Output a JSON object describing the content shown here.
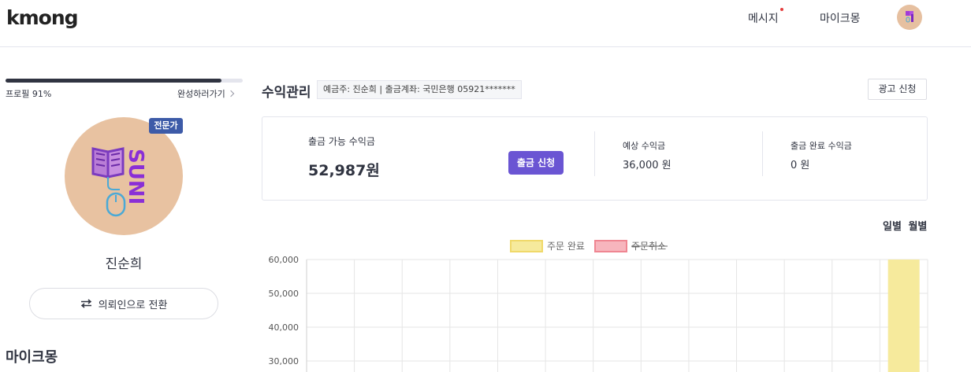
{
  "header": {
    "logo": "kmong",
    "nav": {
      "messages": "메시지",
      "mykmong": "마이크몽"
    }
  },
  "profile": {
    "progress_percent": 91,
    "progress_label": "프로필 91%",
    "complete_link": "완성하러가기",
    "badge": "전문가",
    "name": "진순희",
    "switch_button": "의뢰인으로 전환",
    "section_heading": "마이크몽"
  },
  "revenue": {
    "title": "수익관리",
    "account_info": "예금주: 진순희 | 출금계좌: 국민은행 05921*******",
    "ad_button": "광고 신청",
    "withdrawable_label": "출금 가능 수익금",
    "withdrawable_amount": "52,987원",
    "withdraw_button": "출금 신청",
    "expected_label": "예상 수익금",
    "expected_amount": "36,000 원",
    "completed_label": "출금 완료 수익금",
    "completed_amount": "0 원",
    "period_daily": "일별",
    "period_monthly": "월별"
  },
  "chart_data": {
    "type": "bar",
    "legend": [
      {
        "name": "주문 완료",
        "color": "#f6ea9c",
        "border": "#f0d96a",
        "strikethrough": false
      },
      {
        "name": "주문취소",
        "color": "#f7b5bd",
        "border": "#ef8692",
        "strikethrough": true
      }
    ],
    "y_ticks": [
      "60,000",
      "50,000",
      "40,000",
      "30,000"
    ],
    "ylim_visible": [
      27000,
      60000
    ],
    "x_count": 13,
    "series": [
      {
        "name": "주문 완료",
        "values": [
          0,
          0,
          0,
          0,
          0,
          0,
          0,
          0,
          0,
          0,
          0,
          0,
          60000
        ]
      },
      {
        "name": "주문취소",
        "values": [
          0,
          0,
          0,
          0,
          0,
          0,
          0,
          0,
          0,
          0,
          0,
          0,
          0
        ]
      }
    ],
    "grid": true
  }
}
